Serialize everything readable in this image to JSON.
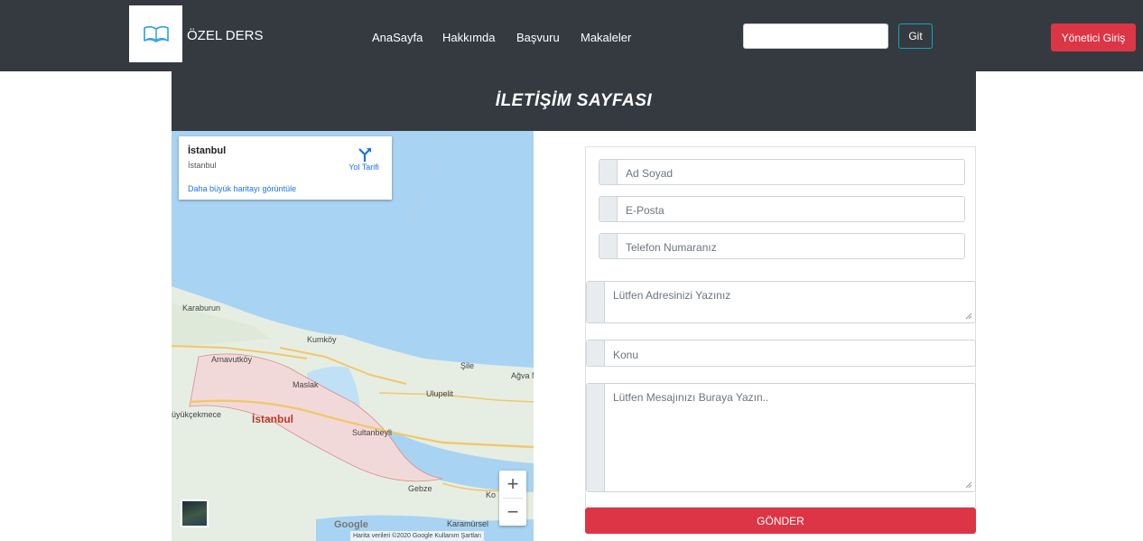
{
  "navbar": {
    "brand": "ÖZEL DERS",
    "links": [
      "AnaSayfa",
      "Hakkımda",
      "Başvuru",
      "Makaleler"
    ],
    "search_placeholder": "",
    "go_label": "Git",
    "admin_label": "Yönetici Giriş",
    "logo_icon": "open-book-icon"
  },
  "page": {
    "title": "İLETİŞİM SAYFASI"
  },
  "map": {
    "place_name": "İstanbul",
    "place_sub": "İstanbul",
    "directions_label": "Yol Tarifi",
    "larger_map_link": "Daha büyük haritayı görüntüle",
    "zoom_in": "+",
    "zoom_out": "−",
    "labels": {
      "karaburun": "Karaburun",
      "kumkoy": "Kumköy",
      "arnavutkoy": "Arnavutköy",
      "sile": "Şile",
      "agva": "Ağva M",
      "maslak": "Maslak",
      "ulupelit": "Ulupelit",
      "buyukcekmece": "üyükçekmece",
      "istanbul": "İstanbul",
      "sultanbeyli": "Sultanbeyli",
      "gebze": "Gebze",
      "karamursel": "Karamürsel",
      "ko": "Ko"
    },
    "google_logo": "Google",
    "footer": "Harita verileri ©2020 Google   Kullanım Şartları"
  },
  "form": {
    "name_placeholder": "Ad Soyad",
    "email_placeholder": "E-Posta",
    "phone_placeholder": "Telefon Numaranız",
    "address_placeholder": "Lütfen Adresinizi Yazınız",
    "subject_placeholder": "Konu",
    "message_placeholder": "Lütfen Mesajınızı Buraya Yazın..",
    "submit_label": "GÖNDER"
  },
  "colors": {
    "navbar_bg": "#343a40",
    "danger": "#dc3545",
    "info": "#17a2b8",
    "map_water": "#a9d3f2",
    "map_land": "#e6eee3"
  }
}
